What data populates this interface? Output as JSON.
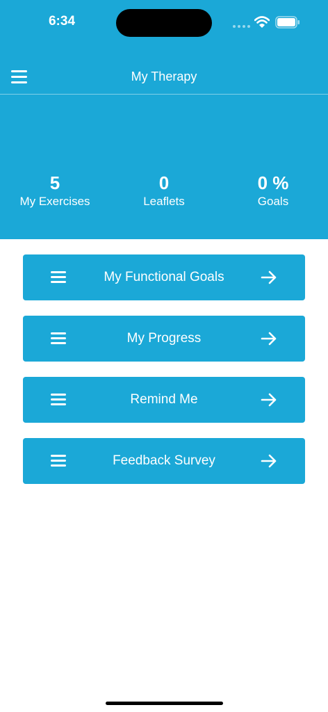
{
  "status_bar": {
    "time": "6:34"
  },
  "nav": {
    "title": "My Therapy",
    "menu_icon": "hamburger-menu-icon"
  },
  "stats": [
    {
      "value": "5",
      "label": "My Exercises"
    },
    {
      "value": "0",
      "label": "Leaflets"
    },
    {
      "value": "0 %",
      "label": "Goals"
    }
  ],
  "actions": [
    {
      "label": "My Functional Goals",
      "leading_icon": "list-icon",
      "trailing_icon": "arrow-right-icon"
    },
    {
      "label": "My Progress",
      "leading_icon": "list-icon",
      "trailing_icon": "arrow-right-icon"
    },
    {
      "label": "Remind Me",
      "leading_icon": "list-icon",
      "trailing_icon": "arrow-right-icon"
    },
    {
      "label": "Feedback Survey",
      "leading_icon": "list-icon",
      "trailing_icon": "arrow-right-icon"
    }
  ],
  "colors": {
    "brand": "#1ba8d7",
    "text_on_brand": "#ffffff",
    "background": "#ffffff"
  }
}
